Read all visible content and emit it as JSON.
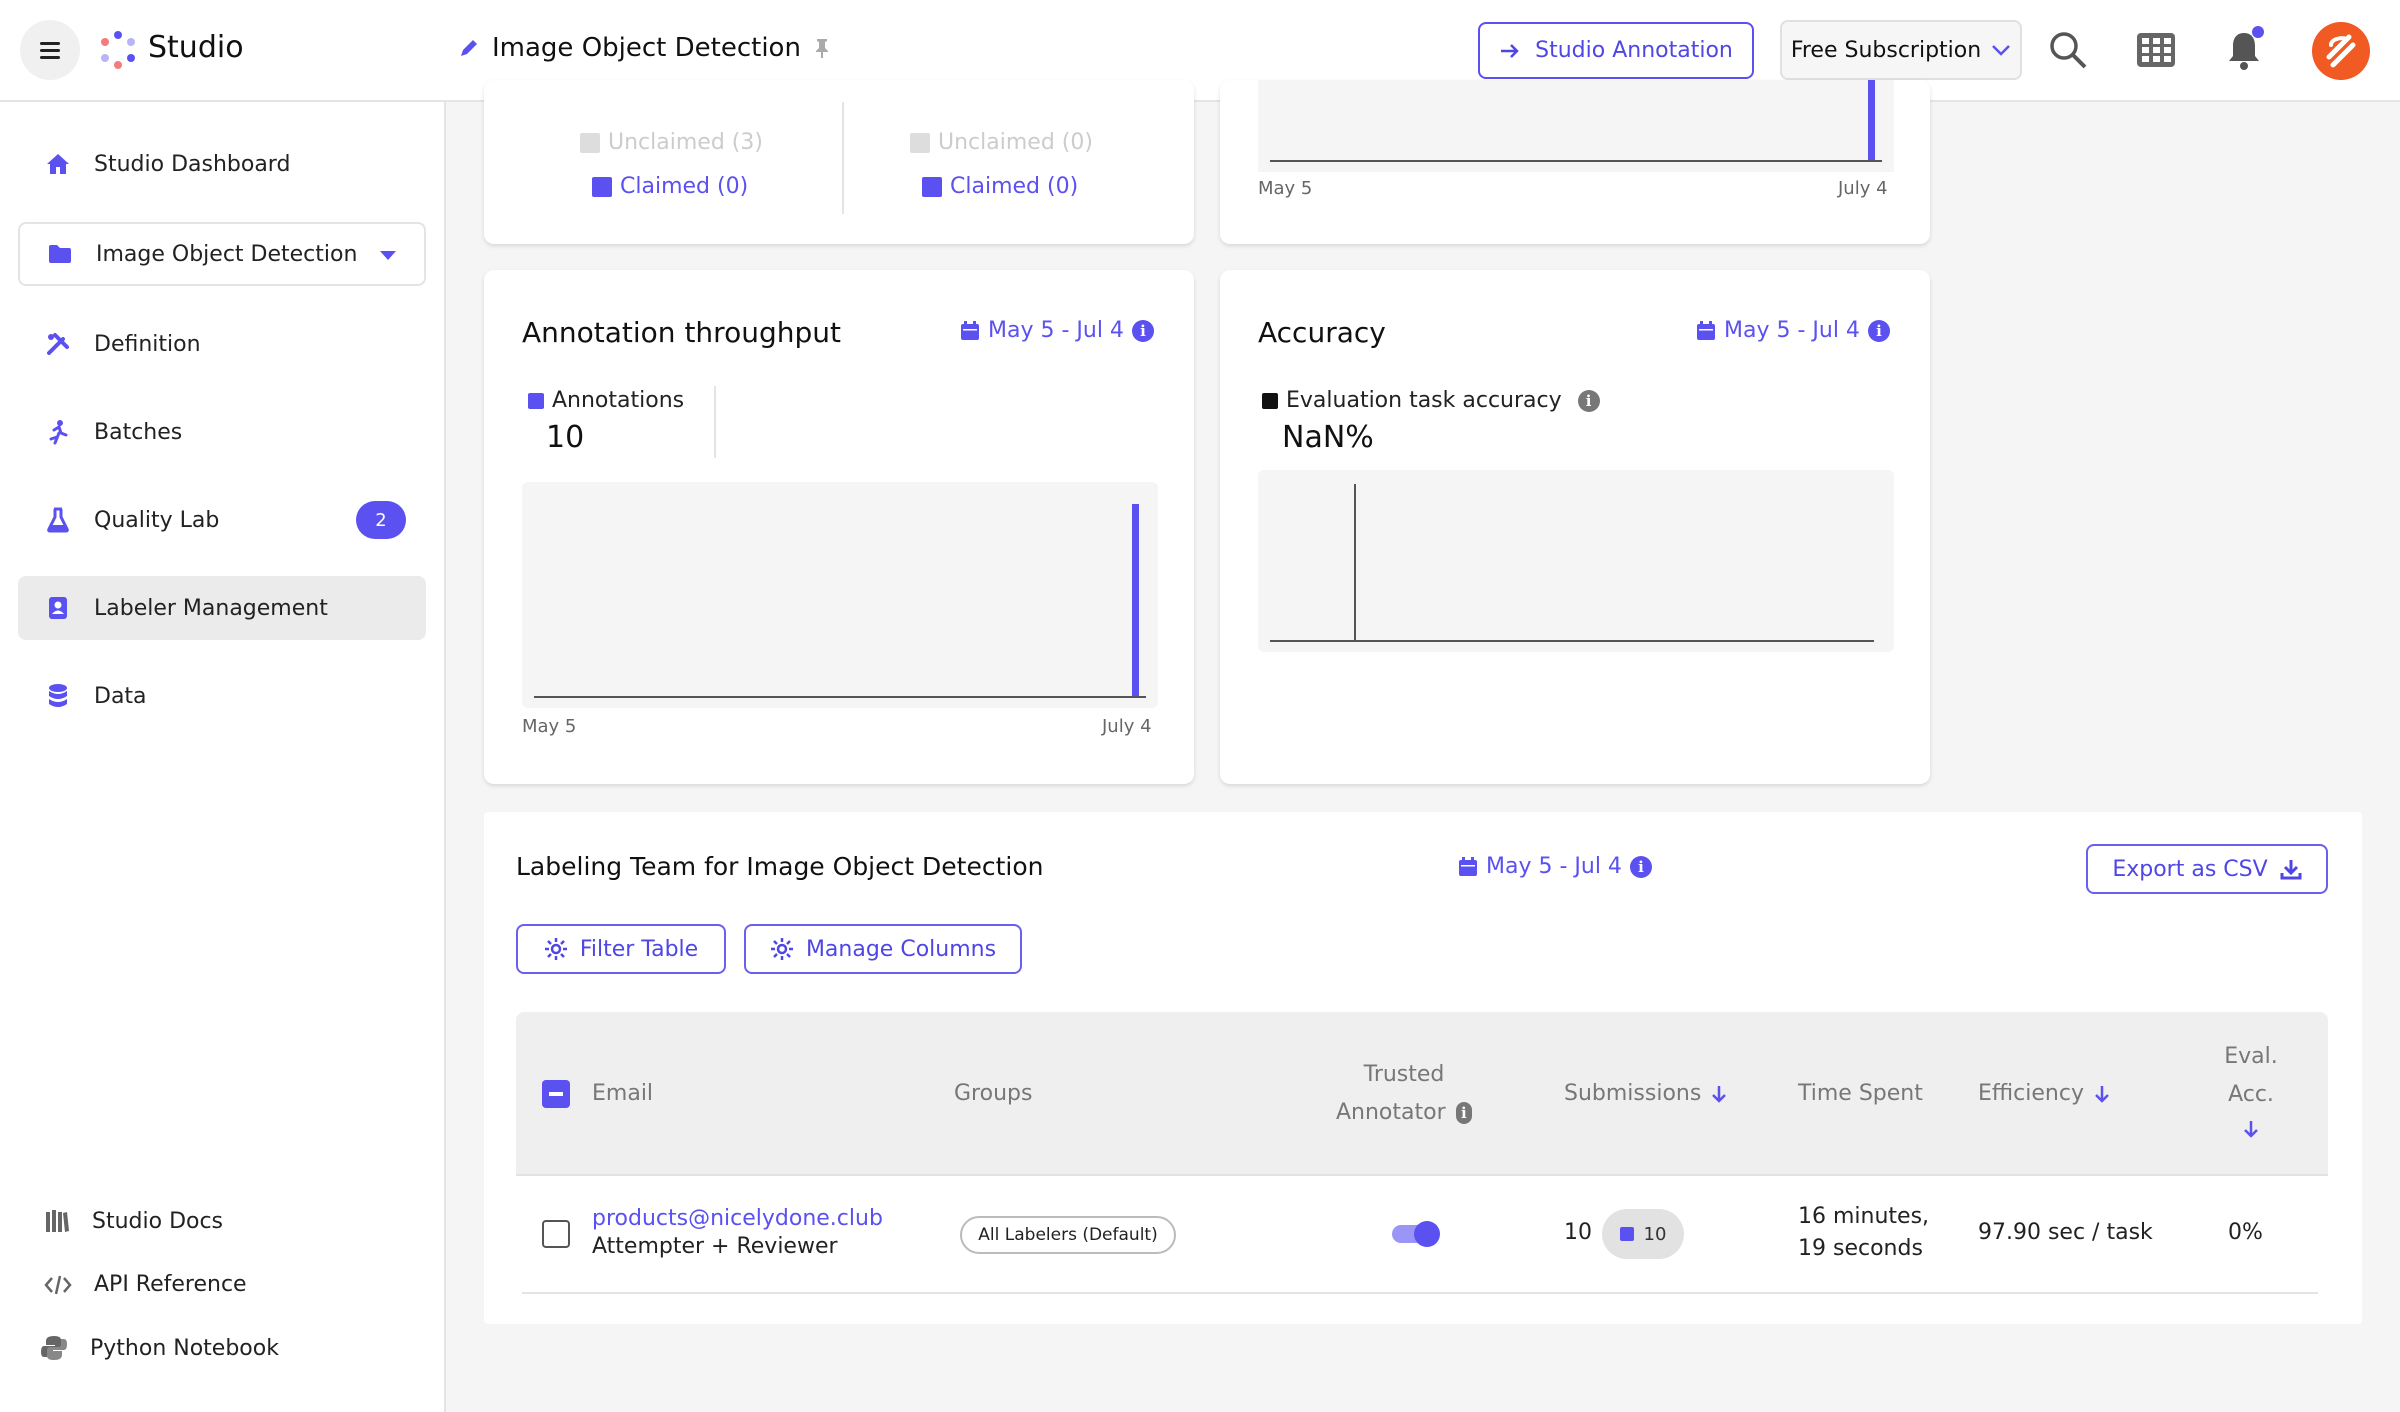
{
  "topbar": {
    "app_title": "Studio",
    "project_title": "Image Object Detection",
    "studio_annotation_label": "Studio Annotation",
    "subscription_label": "Free Subscription"
  },
  "sidebar": {
    "items": [
      {
        "label": "Studio Dashboard"
      },
      {
        "label": "Image Object Detection"
      },
      {
        "label": "Definition"
      },
      {
        "label": "Batches"
      },
      {
        "label": "Quality Lab",
        "badge": "2"
      },
      {
        "label": "Labeler Management"
      },
      {
        "label": "Data"
      }
    ],
    "footer": [
      {
        "label": "Studio Docs"
      },
      {
        "label": "API Reference"
      },
      {
        "label": "Python Notebook"
      }
    ]
  },
  "top_cards": {
    "left": {
      "col1_unclaimed": "Unclaimed (3)",
      "col1_claimed": "Claimed (0)",
      "col2_unclaimed": "Unclaimed (0)",
      "col2_claimed": "Claimed (0)"
    },
    "right": {
      "x_start": "May 5",
      "x_end": "July 4"
    }
  },
  "throughput": {
    "title": "Annotation throughput",
    "date_range": "May 5 - Jul 4",
    "legend": "Annotations",
    "value": "10",
    "x_start": "May 5",
    "x_end": "July 4"
  },
  "accuracy": {
    "title": "Accuracy",
    "date_range": "May 5 - Jul 4",
    "legend": "Evaluation task accuracy",
    "value": "NaN%"
  },
  "team": {
    "title": "Labeling Team for Image Object Detection",
    "date_range": "May 5 - Jul 4",
    "export_label": "Export as CSV",
    "filter_label": "Filter Table",
    "manage_label": "Manage Columns",
    "columns": {
      "email": "Email",
      "groups": "Groups",
      "trusted_1": "Trusted",
      "trusted_2": "Annotator",
      "submissions": "Submissions",
      "time_spent": "Time Spent",
      "efficiency": "Efficiency",
      "eval_1": "Eval.",
      "eval_2": "Acc."
    },
    "rows": [
      {
        "email": "products@nicelydone.club",
        "role": "Attempter + Reviewer",
        "group": "All Labelers (Default)",
        "trusted": true,
        "submissions": "10",
        "submissions_chip": "10",
        "time_1": "16 minutes,",
        "time_2": "19 seconds",
        "efficiency": "97.90 sec / task",
        "eval_acc": "0%"
      }
    ]
  },
  "colors": {
    "accent": "#5b50f0",
    "brand_avatar": "#f15a22",
    "sidebar_active": "#ebebeb"
  }
}
